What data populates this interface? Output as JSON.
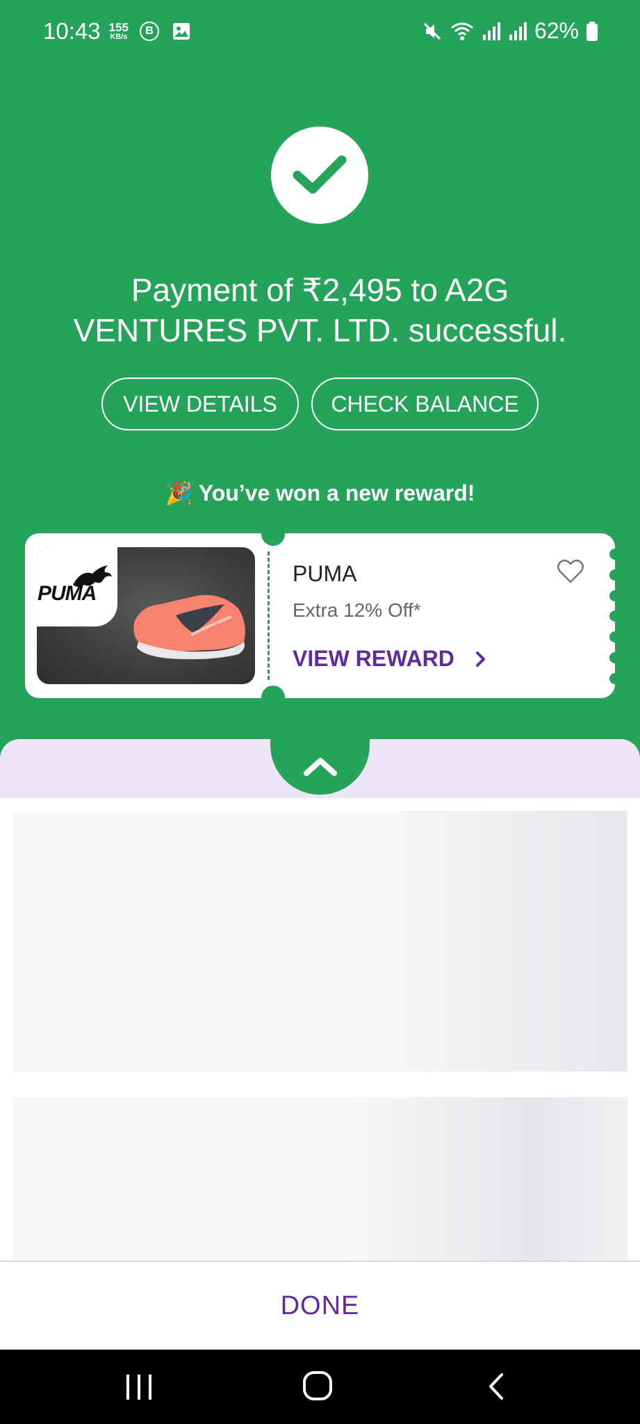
{
  "status_bar": {
    "time": "10:43",
    "speed_value": "155",
    "speed_unit": "KB/s",
    "b_badge": "B",
    "battery": "62%",
    "icons": [
      "mute-icon",
      "wifi-icon",
      "signal-icon",
      "signal-icon",
      "battery-icon"
    ]
  },
  "success": {
    "icon": "check-icon",
    "message": "Payment of ₹2,495 to A2G VENTURES PVT. LTD. successful.",
    "view_details_label": "VIEW DETAILS",
    "check_balance_label": "CHECK BALANCE"
  },
  "reward": {
    "headline_emoji": "🎉",
    "headline": "You’ve won a new reward!",
    "brand": "PUMA",
    "brand_logo_text": "PUMA",
    "offer": "Extra 12% Off*",
    "cta": "VIEW REWARD",
    "favorite_icon": "heart-icon"
  },
  "footer": {
    "done_label": "DONE"
  },
  "colors": {
    "brand_green": "#25a35a",
    "accent_purple": "#5f2aa0",
    "lavender": "#ece5f5"
  }
}
